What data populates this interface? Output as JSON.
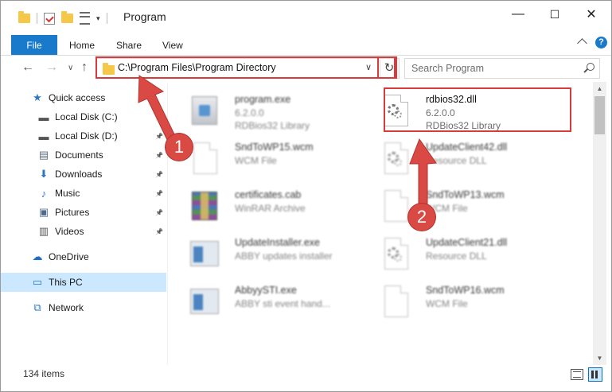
{
  "window": {
    "title": "Program",
    "controls": {
      "minimize": "—",
      "maximize": "☐",
      "close": "✕"
    }
  },
  "ribbon": {
    "tabs": [
      "File",
      "Home",
      "Share",
      "View"
    ]
  },
  "navigation": {
    "back": "←",
    "forward": "→",
    "recent": "∨",
    "up": "↑",
    "address": "C:\\Program Files\\Program Directory",
    "refresh": "↻",
    "search_placeholder": "Search Program"
  },
  "sidebar": {
    "items": [
      {
        "label": "Quick access",
        "icon": "star-icon",
        "pinned": false,
        "indent": 0
      },
      {
        "label": "Local Disk (C:)",
        "icon": "drive-icon",
        "pinned": true,
        "indent": 1
      },
      {
        "label": "Local Disk (D:)",
        "icon": "drive-icon",
        "pinned": true,
        "indent": 1
      },
      {
        "label": "Documents",
        "icon": "documents-icon",
        "pinned": true,
        "indent": 1
      },
      {
        "label": "Downloads",
        "icon": "download-icon",
        "pinned": true,
        "indent": 1
      },
      {
        "label": "Music",
        "icon": "music-icon",
        "pinned": true,
        "indent": 1
      },
      {
        "label": "Pictures",
        "icon": "pictures-icon",
        "pinned": true,
        "indent": 1
      },
      {
        "label": "Videos",
        "icon": "videos-icon",
        "pinned": true,
        "indent": 1
      },
      {
        "label": "OneDrive",
        "icon": "cloud-icon",
        "pinned": false,
        "indent": 0
      },
      {
        "label": "This PC",
        "icon": "computer-icon",
        "pinned": false,
        "indent": 0,
        "selected": true
      },
      {
        "label": "Network",
        "icon": "network-icon",
        "pinned": false,
        "indent": 0
      }
    ]
  },
  "files": [
    {
      "name": "program.exe",
      "line2": "6.2.0.0",
      "line3": "RDBios32 Library",
      "icon": "setup-icon",
      "blur": true
    },
    {
      "name": "rdbios32.dll",
      "line2": "6.2.0.0",
      "line3": "RDBios32 Library",
      "icon": "dll-gear-icon",
      "blur": false
    },
    {
      "name": "SndToWP15.wcm",
      "line2": "WCM File",
      "line3": "",
      "icon": "blank-file-icon",
      "blur": true
    },
    {
      "name": "UpdateClient42.dll",
      "line2": "Resource DLL",
      "line3": "",
      "icon": "dll-gear-icon",
      "blur": true
    },
    {
      "name": "certificates.cab",
      "line2": "WinRAR Archive",
      "line3": "",
      "icon": "winrar-icon",
      "blur": true
    },
    {
      "name": "SndToWP13.wcm",
      "line2": "WCM File",
      "line3": "",
      "icon": "blank-file-icon",
      "blur": true
    },
    {
      "name": "UpdateInstaller.exe",
      "line2": "ABBY updates installer",
      "line3": "",
      "icon": "app-window-icon",
      "blur": true
    },
    {
      "name": "UpdateClient21.dll",
      "line2": "Resource DLL",
      "line3": "",
      "icon": "dll-gear-icon",
      "blur": true
    },
    {
      "name": "AbbyySTI.exe",
      "line2": "ABBY sti event hand...",
      "line3": "",
      "icon": "app-window-icon",
      "blur": true
    },
    {
      "name": "SndToWP16.wcm",
      "line2": "WCM File",
      "line3": "",
      "icon": "blank-file-icon",
      "blur": true
    }
  ],
  "status": {
    "item_count": "134 items"
  },
  "annotations": [
    {
      "number": "1",
      "target": "address-bar"
    },
    {
      "number": "2",
      "target": "rdbios32.dll"
    }
  ],
  "colors": {
    "accent": "#1979ca",
    "selection": "#cce8ff",
    "annotation": "#d93b3b"
  }
}
